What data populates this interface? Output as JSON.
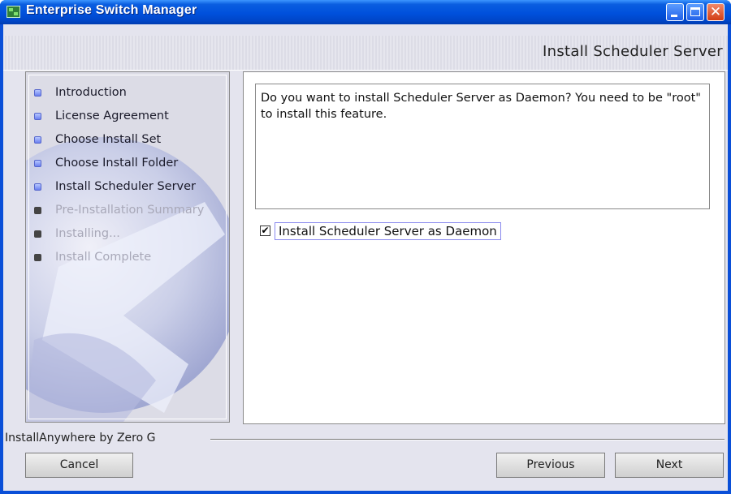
{
  "window": {
    "title": "Enterprise Switch Manager",
    "controls": {
      "minimize": "minimize-icon",
      "maximize": "maximize-icon",
      "close": "✕"
    }
  },
  "header": {
    "page_title": "Install Scheduler Server"
  },
  "steps": [
    {
      "label": "Introduction",
      "state": "done"
    },
    {
      "label": "License Agreement",
      "state": "done"
    },
    {
      "label": "Choose Install Set",
      "state": "done"
    },
    {
      "label": "Choose Install Folder",
      "state": "done"
    },
    {
      "label": "Install Scheduler Server",
      "state": "current"
    },
    {
      "label": "Pre-Installation Summary",
      "state": "pending"
    },
    {
      "label": "Installing...",
      "state": "pending"
    },
    {
      "label": "Install Complete",
      "state": "pending"
    }
  ],
  "main": {
    "message": "Do you want to install Scheduler Server as Daemon? You need to be \"root\" to install this feature.",
    "checkbox": {
      "label": "Install Scheduler Server as Daemon",
      "checked": true,
      "mark": "✔"
    }
  },
  "footer": {
    "vendor": "InstallAnywhere by Zero G",
    "cancel": "Cancel",
    "previous": "Previous",
    "next": "Next"
  },
  "colors": {
    "titlebar": "#0050dc",
    "panel_bg": "#e4e4ee",
    "pending_text": "#a8a8b8"
  }
}
